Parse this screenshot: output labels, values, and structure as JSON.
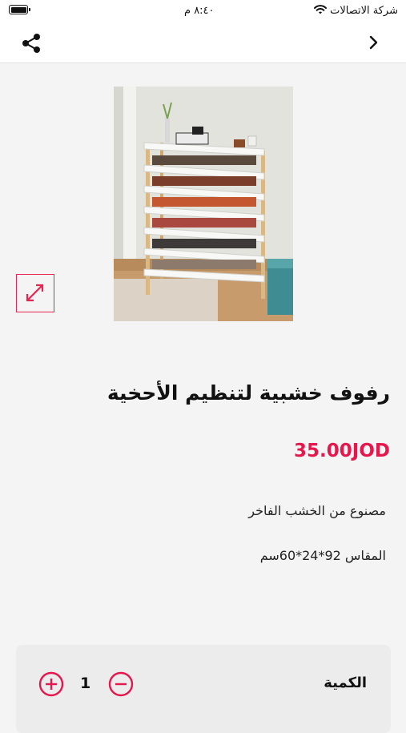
{
  "status_bar": {
    "carrier": "شركة الاتصالات",
    "time": "٨:٤٠ م",
    "icons": [
      "wifi-icon",
      "battery-icon"
    ]
  },
  "nav": {
    "icons": [
      "share-icon",
      "chevron-right-icon"
    ]
  },
  "product": {
    "image_icon": "product-image",
    "title": "رفوف خشبية لتنظيم الأحخية",
    "price": "35.00JOD",
    "description": [
      "مصنوع من الخشب الفاخر",
      "المقاس 92*24*60سم"
    ]
  },
  "quantity": {
    "label": "الكمية",
    "value": "1"
  },
  "colors": {
    "accent": "#e6174d",
    "background": "#f4f4f4",
    "card": "#ececec"
  }
}
